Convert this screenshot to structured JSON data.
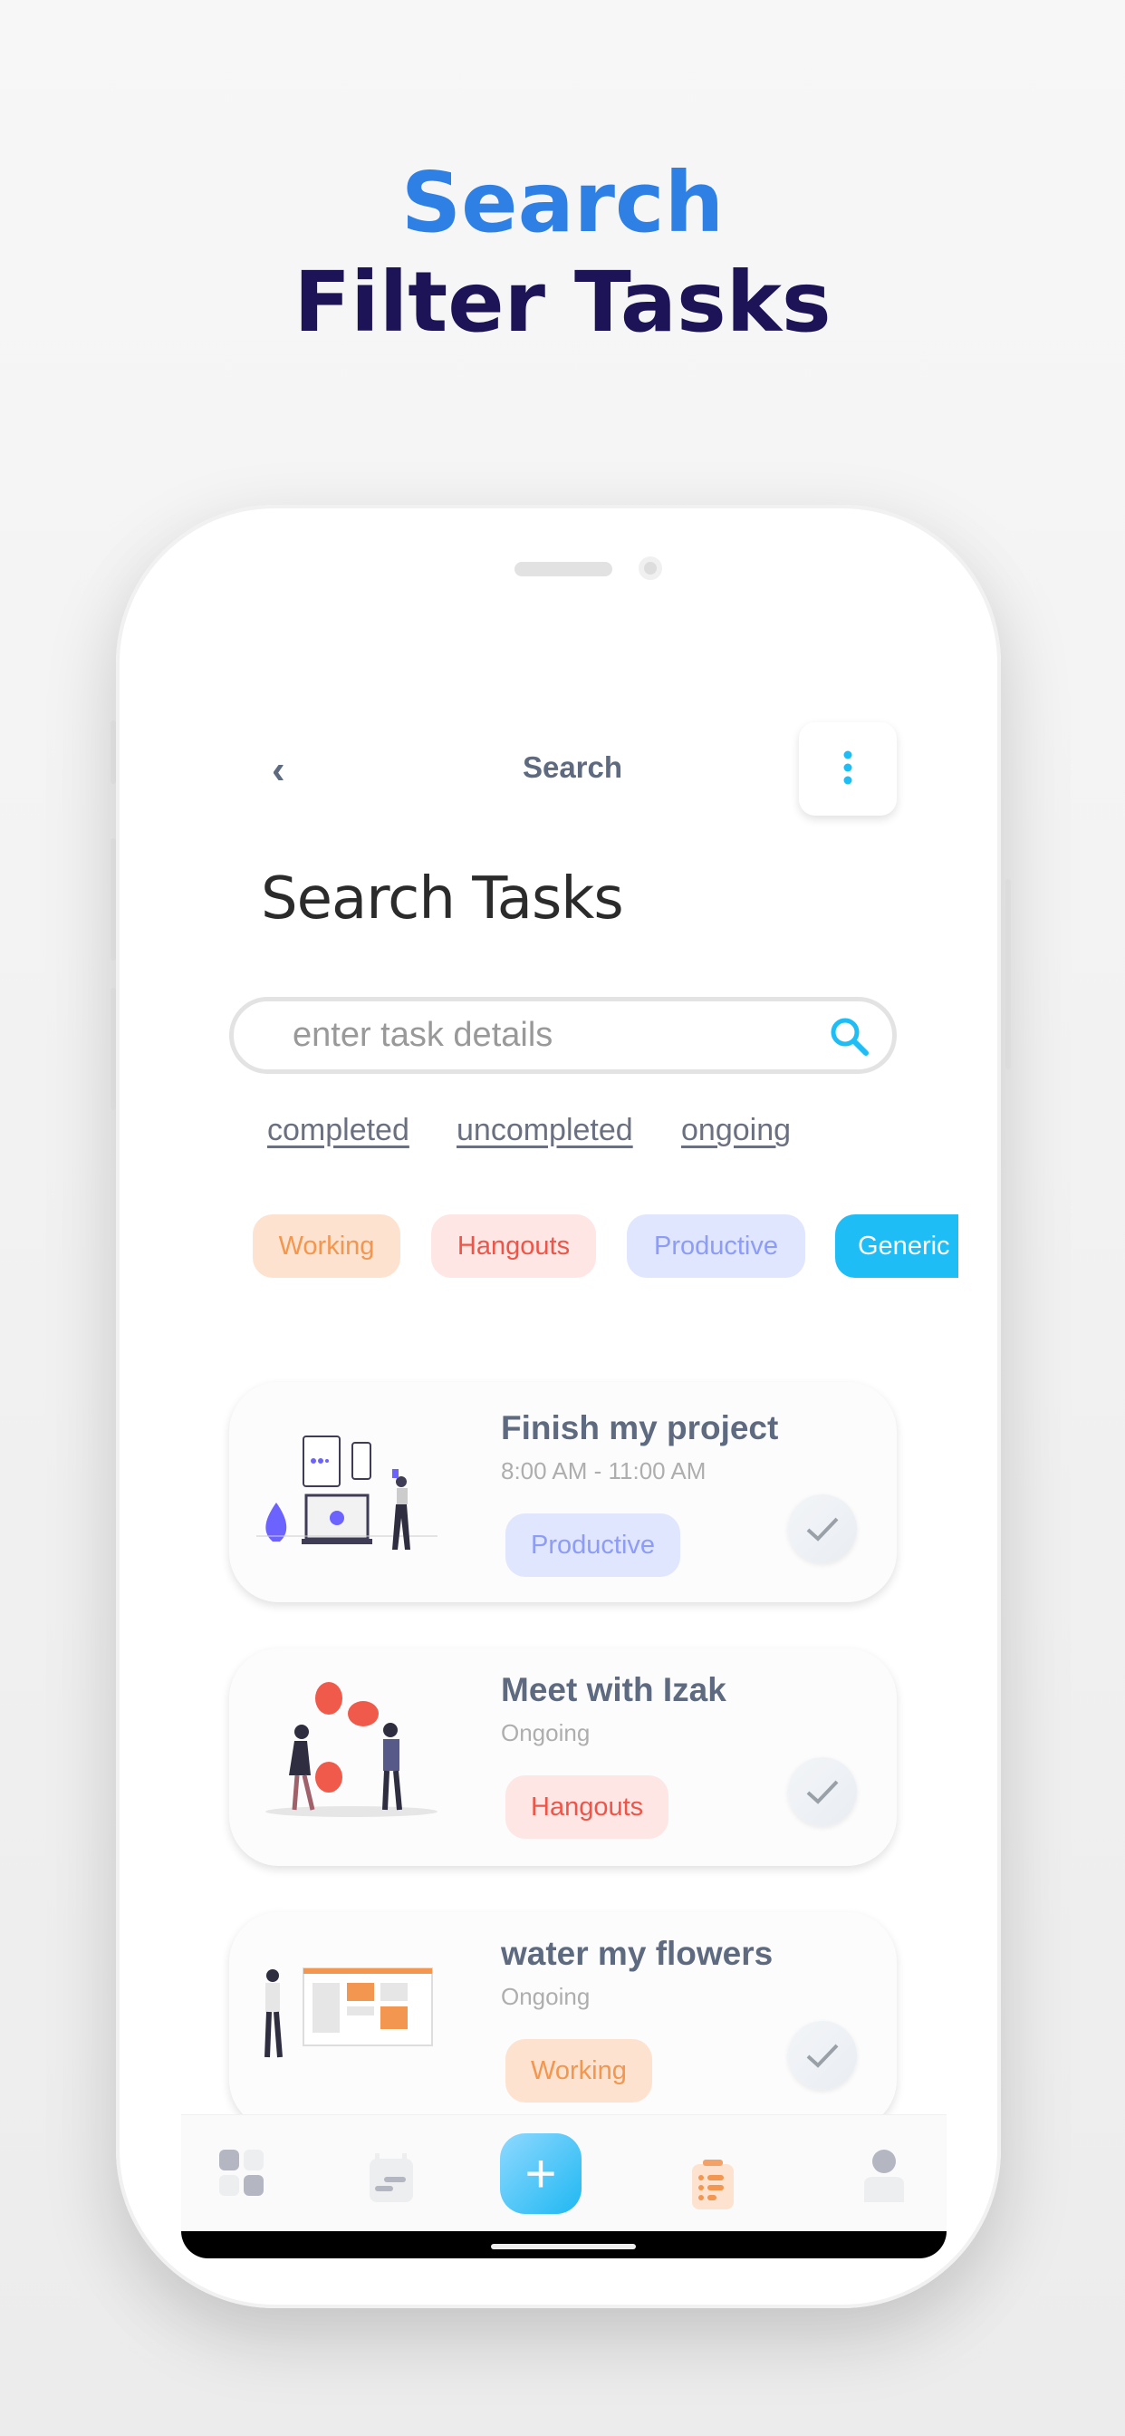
{
  "promo": {
    "line1": "Search",
    "line2": "Filter Tasks"
  },
  "header": {
    "title": "Search",
    "back_icon": "chevron-left-icon",
    "menu_icon": "more-vertical-icon"
  },
  "page_title": "Search Tasks",
  "search": {
    "placeholder": "enter task details",
    "value": "",
    "icon": "search-icon"
  },
  "filters": [
    "completed",
    "uncompleted",
    "ongoing"
  ],
  "categories": [
    {
      "label": "Working",
      "bg": "#fde3cf",
      "color": "#f29650"
    },
    {
      "label": "Hangouts",
      "bg": "#fde6e4",
      "color": "#ee5548"
    },
    {
      "label": "Productive",
      "bg": "#dfe6fd",
      "color": "#8d9cf6"
    },
    {
      "label": "Generic",
      "bg": "#1fbdf6",
      "color": "#ffffff",
      "selected": true
    }
  ],
  "tasks": [
    {
      "title": "Finish my project",
      "subtitle": "8:00 AM - 11:00 AM",
      "tag": "Productive"
    },
    {
      "title": "Meet with Izak",
      "subtitle": "Ongoing",
      "tag": "Hangouts"
    },
    {
      "title": "water my flowers",
      "subtitle": "Ongoing",
      "tag": "Working"
    }
  ],
  "nav": {
    "items": [
      "dashboard-icon",
      "calendar-icon",
      "add-icon",
      "tasks-clipboard-icon",
      "profile-icon"
    ],
    "active": "tasks-clipboard-icon"
  },
  "colors": {
    "accent": "#1fbdf6",
    "promo_blue": "#2f80e4",
    "promo_dark": "#1c1457"
  }
}
